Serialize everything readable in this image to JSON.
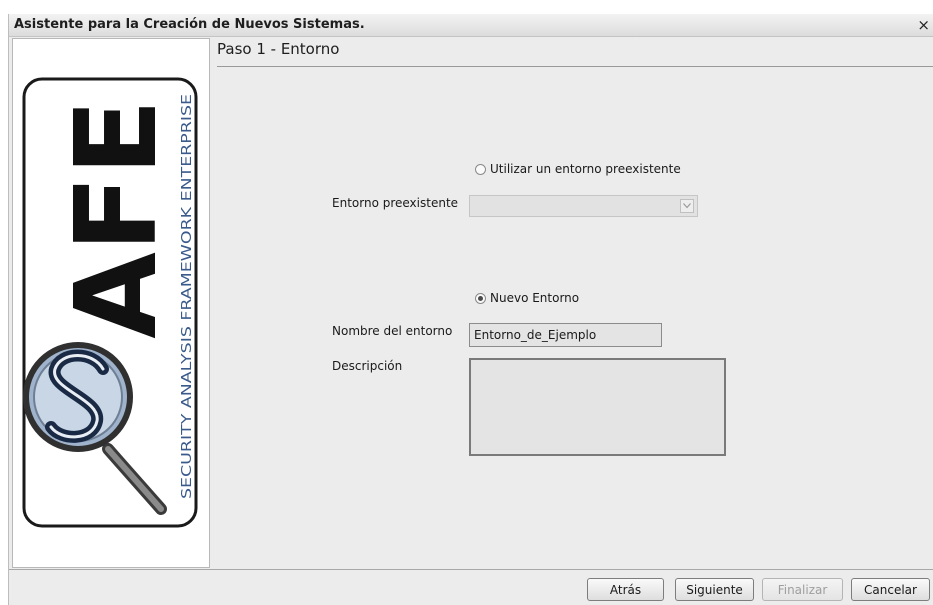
{
  "window": {
    "title": "Asistente para la Creación de Nuevos Sistemas.",
    "close_glyph": "×"
  },
  "step": {
    "title": "Paso 1 - Entorno"
  },
  "logo": {
    "letters": "AFE",
    "tagline": "SECURITY ANALYSIS FRAMEWORK ENTERPRISE",
    "icon": "magnifying-glass-s-logo-icon"
  },
  "form": {
    "option_existing": {
      "label": "Utilizar un entorno preexistente",
      "selected": false
    },
    "existing_env_label": "Entorno preexistente",
    "existing_env_value": "",
    "option_new": {
      "label": "Nuevo Entorno",
      "selected": true
    },
    "name_label": "Nombre del entorno",
    "name_value": "Entorno_de_Ejemplo",
    "description_label": "Descripción",
    "description_value": ""
  },
  "buttons": {
    "back": "Atrás",
    "next": "Siguiente",
    "finish": "Finalizar",
    "cancel": "Cancelar"
  },
  "colors": {
    "window_bg": "#ececec",
    "logo_blue": "#3a5a8c"
  }
}
